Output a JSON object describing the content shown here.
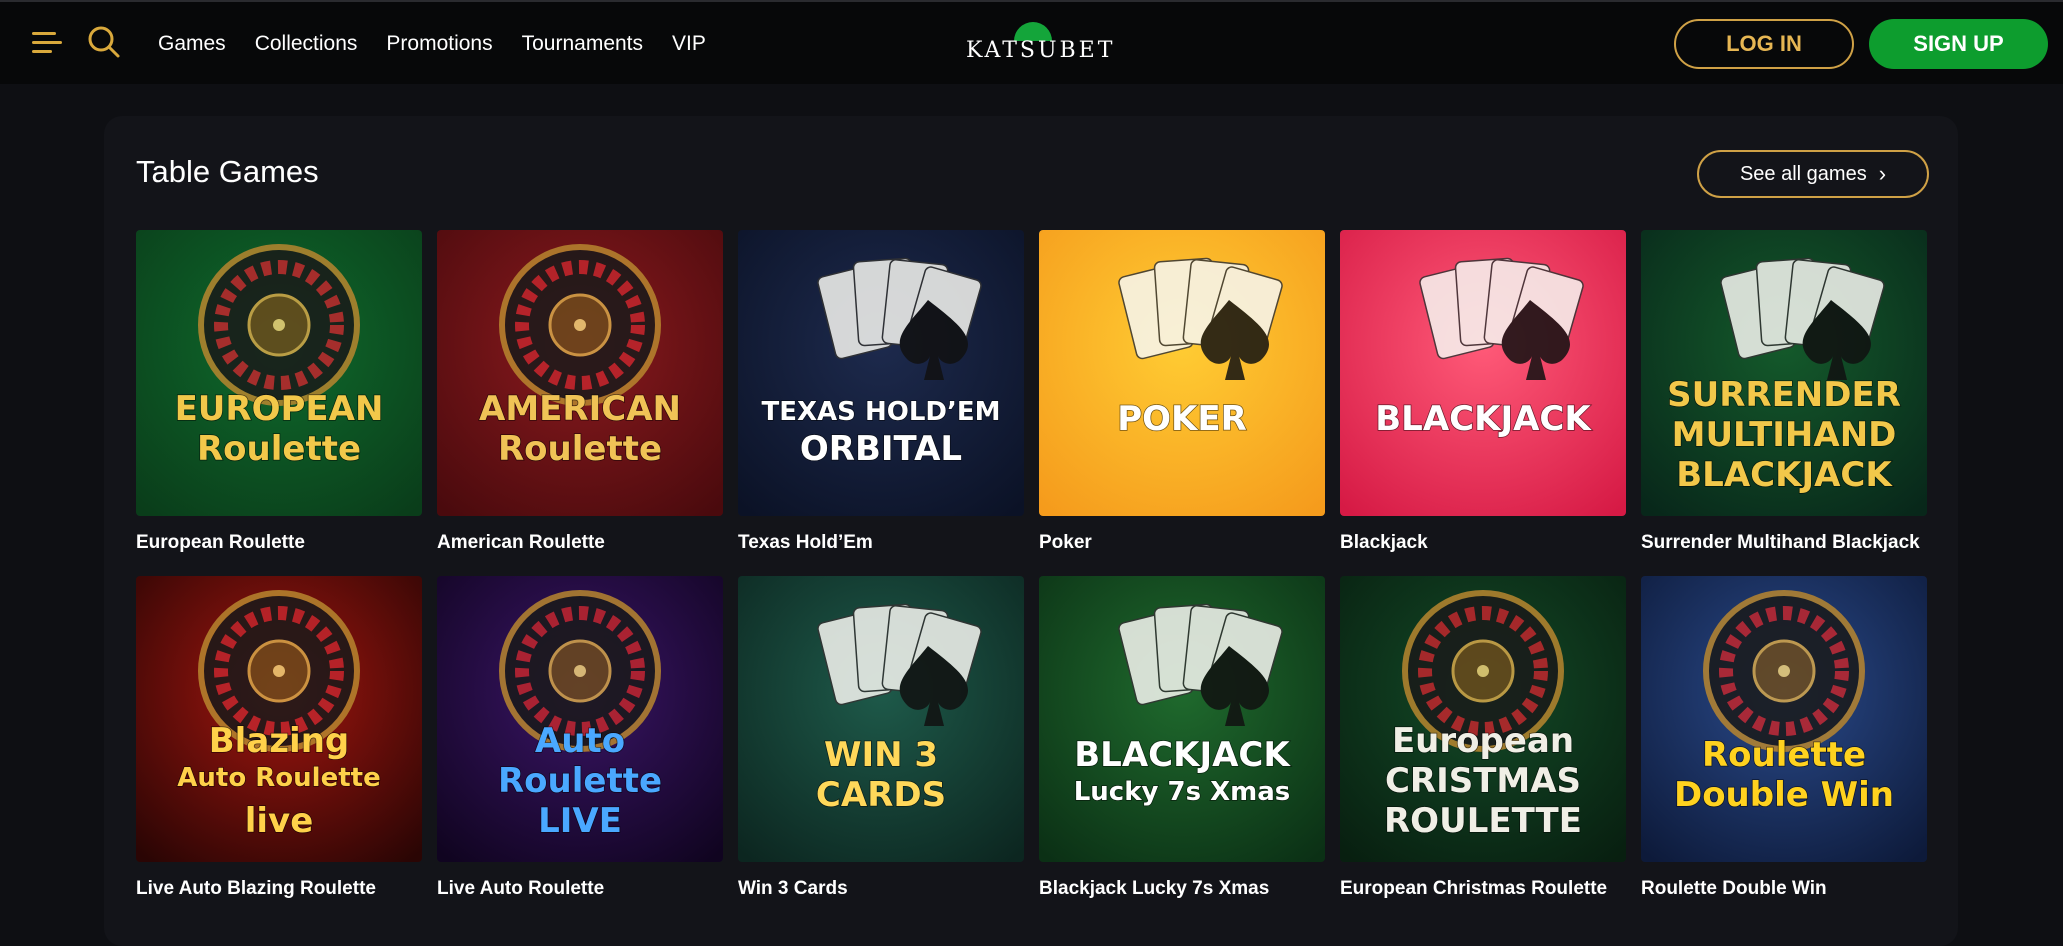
{
  "header": {
    "menu_icon": "hamburger-menu-icon",
    "search_icon": "search-icon",
    "nav_items": [
      "Games",
      "Collections",
      "Promotions",
      "Tournaments",
      "VIP"
    ],
    "logo_text": "KATSUBET",
    "login_label": "LOG IN",
    "signup_label": "SIGN UP"
  },
  "section": {
    "title": "Table Games",
    "see_all_label": "See all games",
    "see_all_icon": "chevron-right-icon"
  },
  "games": [
    {
      "name": "European Roulette",
      "art_lines": [
        "EUROPEAN",
        "Roulette"
      ],
      "palette": [
        "#0f6a2c",
        "#0a3d1a"
      ],
      "text_color": "#f2c84a"
    },
    {
      "name": "American Roulette",
      "art_lines": [
        "AMERICAN",
        "Roulette"
      ],
      "palette": [
        "#8a1a1e",
        "#4a0a0d"
      ],
      "text_color": "#f0c356"
    },
    {
      "name": "Texas Hold’Em",
      "art_lines": [
        "TEXAS HOLD’EM",
        "ORBITAL"
      ],
      "palette": [
        "#1d2a4d",
        "#0b1226"
      ],
      "text_color": "#ffffff"
    },
    {
      "name": "Poker",
      "art_lines": [
        "POKER"
      ],
      "palette": [
        "#ffcc33",
        "#f59b1c"
      ],
      "text_color": "#ffffff"
    },
    {
      "name": "Blackjack",
      "art_lines": [
        "BLACKJACK"
      ],
      "palette": [
        "#ff5a78",
        "#d61a45"
      ],
      "text_color": "#ffffff"
    },
    {
      "name": "Surrender Multihand Blackjack",
      "art_lines": [
        "SURRENDER",
        "MULTIHAND",
        "BLACKJACK"
      ],
      "palette": [
        "#145a2b",
        "#08271a"
      ],
      "text_color": "#f2c84a"
    },
    {
      "name": "Live Auto Blazing Roulette",
      "art_lines": [
        "Blazing",
        "Auto Roulette",
        "live"
      ],
      "palette": [
        "#a2160f",
        "#2a0504"
      ],
      "text_color": "#ffd14a"
    },
    {
      "name": "Live Auto Roulette",
      "art_lines": [
        "Auto",
        "Roulette",
        "LIVE"
      ],
      "palette": [
        "#3a1566",
        "#100420"
      ],
      "text_color": "#4aa8ff"
    },
    {
      "name": "Win 3 Cards",
      "art_lines": [
        "WIN 3",
        "CARDS"
      ],
      "palette": [
        "#1e5a4a",
        "#0c2620"
      ],
      "text_color": "#ffd85a"
    },
    {
      "name": "Blackjack Lucky 7s Xmas",
      "art_lines": [
        "BLACKJACK",
        "Lucky 7s Xmas"
      ],
      "palette": [
        "#1f6a2d",
        "#0b3015"
      ],
      "text_color": "#ffffff"
    },
    {
      "name": "European Christmas Roulette",
      "art_lines": [
        "European",
        "CRISTMAS",
        "ROULETTE"
      ],
      "palette": [
        "#134a27",
        "#081f10"
      ],
      "text_color": "#f0efe6"
    },
    {
      "name": "Roulette Double Win",
      "art_lines": [
        "Roulette",
        "Double Win"
      ],
      "palette": [
        "#2a4a8a",
        "#0d1a3a"
      ],
      "text_color": "#ffd21f"
    }
  ]
}
